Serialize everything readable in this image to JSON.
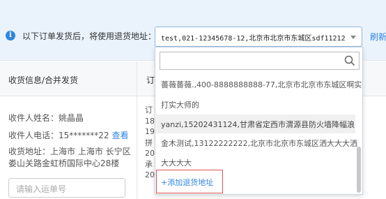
{
  "notice": {
    "text": "以下订单发货后，将使用退货地址：",
    "selected_address": "test,021-12345678-12,北京市北京市东城区sdf11212",
    "refresh_label": "刷新"
  },
  "table": {
    "col1_header": "收货信息/合并发货",
    "col2_header": "订"
  },
  "receiver": {
    "name_line": "收件人姓名：姚晶晶",
    "phone_line": "收件人电话：15*******22",
    "view_label": "查看",
    "address_line": "收货地址：上海市 上海市 长宁区娄山关路金虹桥国际中心28楼",
    "tracking_placeholder": "请输入运单号"
  },
  "order_partial": [
    "订",
    "18",
    "19",
    "拼",
    "20",
    "承",
    "20"
  ],
  "dropdown": {
    "search_value": "",
    "options": [
      "薔薇薔薇.,400-8888888888-77,北京市北京市东城区啊实",
      "打实大师的",
      "yanzi,15202431124,甘肃省定西市渭源县防火墙降幅浪",
      "金木测试,13122222222,北京市北京市东城区洒大大大洒",
      "大大大大"
    ],
    "add_label": "+添加退货地址"
  }
}
